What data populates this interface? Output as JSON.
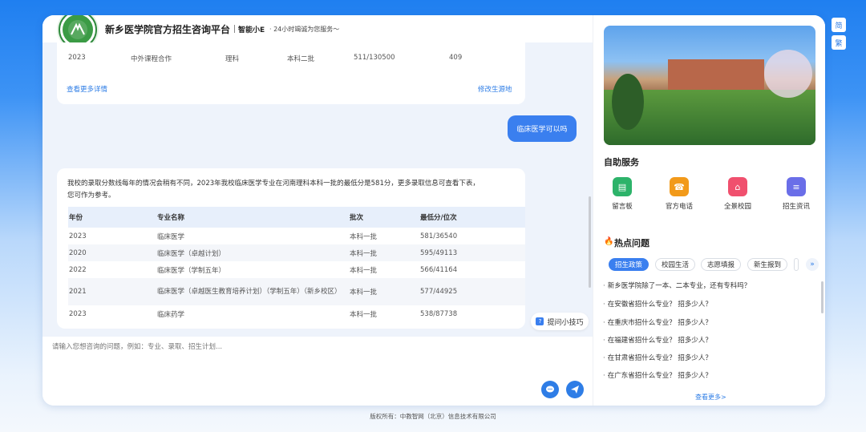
{
  "header": {
    "title": "新乡医学院官方招生咨询平台",
    "assistant_name": "智能小E",
    "slogan": "· 24小时竭诚为您服务～"
  },
  "chat": {
    "previous_card": {
      "row": [
        "2023",
        "中外课程合作",
        "理科",
        "本科二批",
        "511/130500",
        "409"
      ],
      "more_link": "查看更多详情",
      "change_link": "修改生源地"
    },
    "user_message": "临床医学可以吗",
    "bot_reply": {
      "text_line1": "我校的录取分数线每年的情况会稍有不同，2023年我校临床医学专业在河南理科本科一批的最低分是581分，更多录取信息可查看下表，",
      "text_line2": "您可作为参考。",
      "columns": [
        "年份",
        "专业名称",
        "批次",
        "最低分/位次"
      ],
      "rows": [
        {
          "year": "2023",
          "major": "临床医学",
          "batch": "本科一批",
          "score": "581/36540"
        },
        {
          "year": "2020",
          "major": "临床医学（卓越计划）",
          "batch": "本科一批",
          "score": "595/49113"
        },
        {
          "year": "2022",
          "major": "临床医学（学制五年）",
          "batch": "本科一批",
          "score": "566/41164"
        },
        {
          "year": "2021",
          "major": "临床医学（卓越医生教育培养计划）（学制五年）（新乡校区）",
          "batch": "本科一批",
          "score": "577/44925"
        },
        {
          "year": "2023",
          "major": "临床药学",
          "batch": "本科一批",
          "score": "538/87738"
        }
      ]
    },
    "tip_button": "提问小技巧"
  },
  "input": {
    "placeholder": "请输入您想咨询的问题，例如：专业、录取、招生计划..."
  },
  "sidebar": {
    "self_service_title": "自助服务",
    "services": [
      {
        "label": "留言板",
        "icon": "message-board-icon",
        "color": "#2db36a"
      },
      {
        "label": "官方电话",
        "icon": "phone-icon",
        "color": "#f29a1a"
      },
      {
        "label": "全景校园",
        "icon": "campus-icon",
        "color": "#f0506e"
      },
      {
        "label": "招生资讯",
        "icon": "news-icon",
        "color": "#6a6ee8"
      }
    ],
    "hot_title": "热点问题",
    "tags": [
      "招生政策",
      "校园生活",
      "志愿填报",
      "新生报到"
    ],
    "questions": [
      "新乡医学院除了一本、二本专业，还有专科吗？",
      "在安徽省招什么专业？ 招多少人？",
      "在重庆市招什么专业？ 招多少人？",
      "在福建省招什么专业？ 招多少人？",
      "在甘肃省招什么专业？ 招多少人？",
      "在广东省招什么专业？ 招多少人？"
    ],
    "more": "查看更多>"
  },
  "lang": {
    "simplified": "简",
    "traditional": "繁"
  },
  "footer": "版权所有：中教智网（北京）信息技术有限公司"
}
